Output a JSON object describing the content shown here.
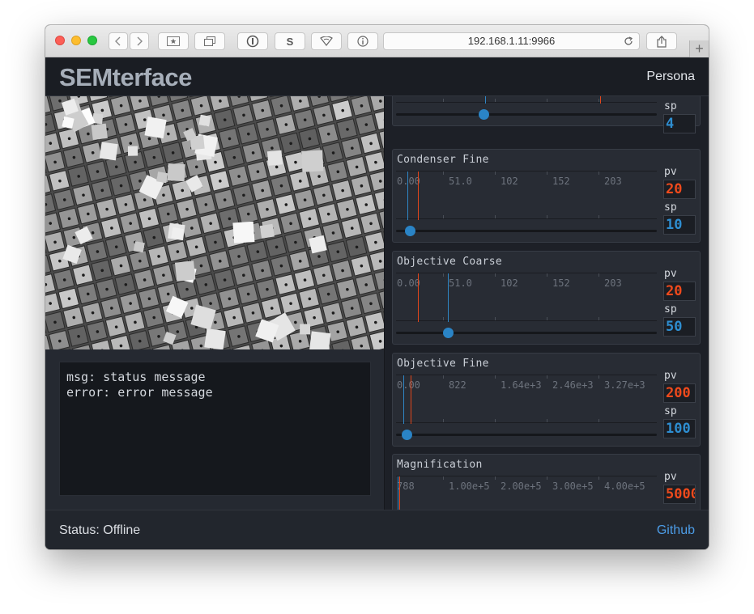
{
  "browser": {
    "url": "192.168.1.11:9966",
    "new_tab_label": "+"
  },
  "app": {
    "title": "SEMterface",
    "persona_label": "Persona"
  },
  "log": {
    "lines": [
      "msg: status message",
      "error: error message"
    ]
  },
  "controls": [
    {
      "id": "partial-top",
      "title": "",
      "ticks": [],
      "sp_label": "sp",
      "sp_value": "4"
    },
    {
      "id": "condenser-fine",
      "title": "Condenser Fine",
      "ticks": [
        "0.00",
        "51.0",
        "102",
        "152",
        "203"
      ],
      "pv_label": "pv",
      "pv_value": "20",
      "sp_label": "sp",
      "sp_value": "10"
    },
    {
      "id": "objective-coarse",
      "title": "Objective Coarse",
      "ticks": [
        "0.00",
        "51.0",
        "102",
        "152",
        "203"
      ],
      "pv_label": "pv",
      "pv_value": "20",
      "sp_label": "sp",
      "sp_value": "50"
    },
    {
      "id": "objective-fine",
      "title": "Objective Fine",
      "ticks": [
        "0.00",
        "822",
        "1.64e+3",
        "2.46e+3",
        "3.27e+3"
      ],
      "pv_label": "pv",
      "pv_value": "200",
      "sp_label": "sp",
      "sp_value": "100"
    },
    {
      "id": "magnification",
      "title": "Magnification",
      "ticks": [
        "788",
        "1.00e+5",
        "2.00e+5",
        "3.00e+5",
        "4.00e+5"
      ],
      "pv_label": "pv",
      "pv_value": "5000"
    }
  ],
  "footer": {
    "status": "Status: Offline",
    "github": "Github"
  },
  "colors": {
    "pv": "#f04a1c",
    "sp": "#2e8ed1",
    "accent_link": "#4c9ce6"
  }
}
